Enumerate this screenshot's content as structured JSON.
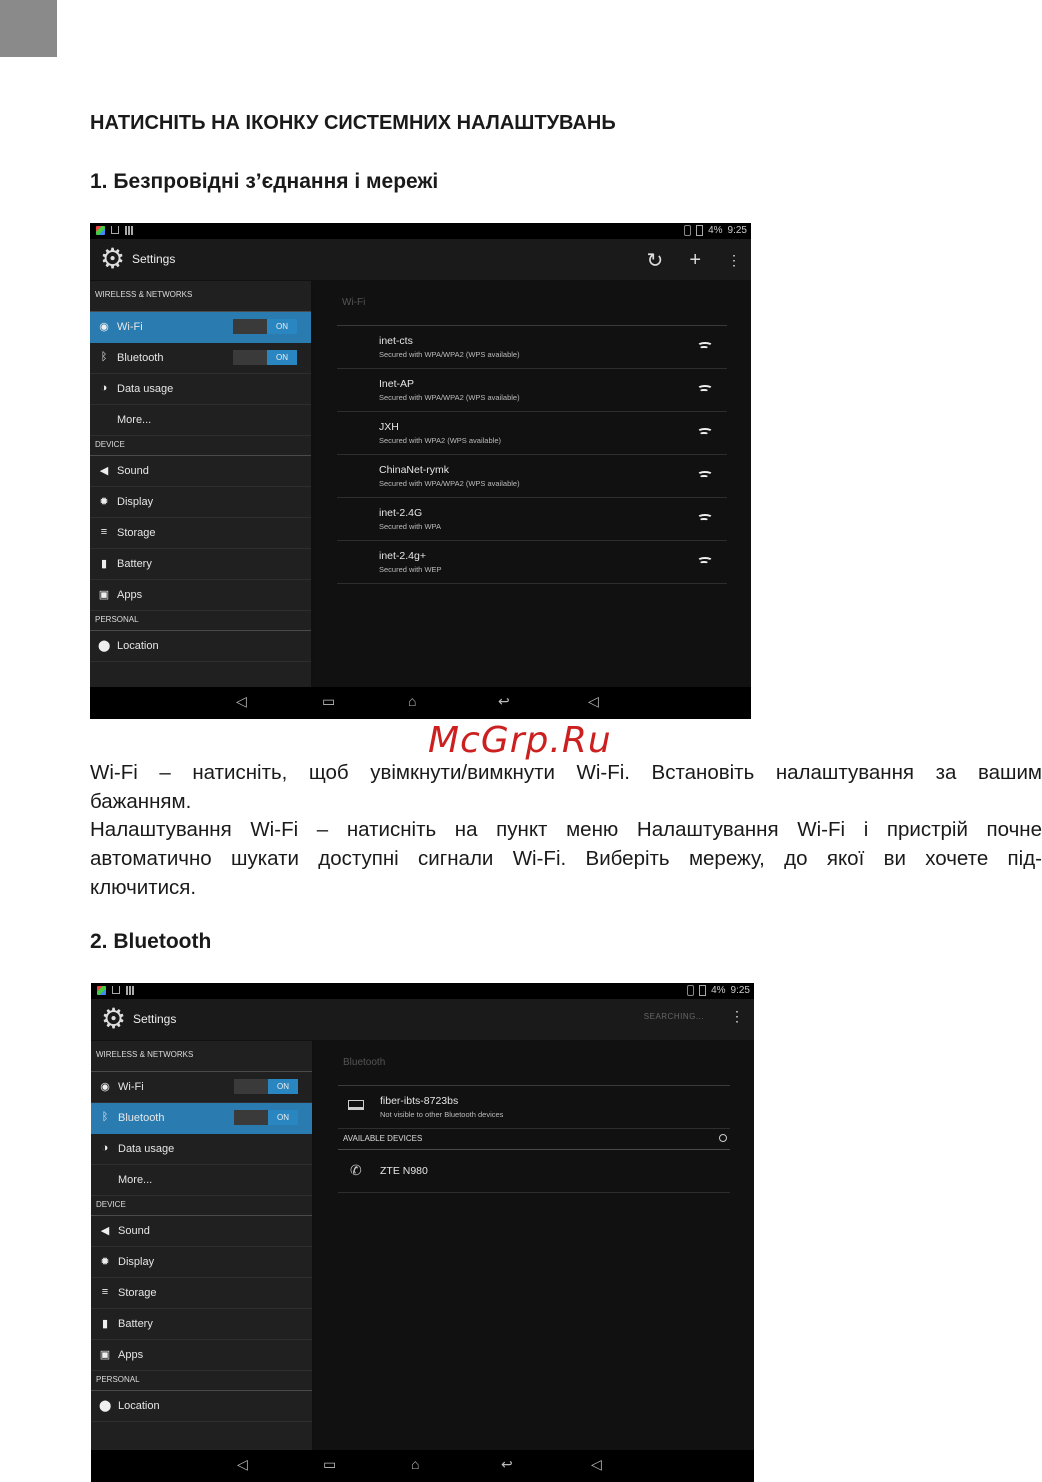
{
  "doc": {
    "heading": "НАТИСНІТЬ НА ІКОНКУ СИСТЕМНИХ НАЛАШТУВАНЬ",
    "section1": "1. Безпровідні з’єднання і мережі",
    "section2": "2. Bluetooth",
    "watermark": "McGrp.Ru",
    "para1_line1": "Wi-Fi – натисніть, щоб увімкнути/вимкнути Wi-Fi. Встановіть налаштування за вашим",
    "para1_line2": "бажанням.",
    "para2_line1": "Налаштування Wi-Fi – натисніть на пункт меню Налаштування Wi-Fi і пристрій почне",
    "para2_line2": "автоматично шукати доступні сигнали Wi-Fi. Виберіть мережу, до якої ви хочете під-",
    "para2_line3": "ключитися."
  },
  "screen": {
    "time": "9:25",
    "battery": "4%",
    "title": "Settings",
    "searching": "SEARCHING...",
    "toggle_on": "ON",
    "sections": {
      "wireless": "WIRELESS & NETWORKS",
      "device": "DEVICE",
      "personal": "PERSONAL"
    },
    "menu": {
      "wifi": "Wi-Fi",
      "bluetooth": "Bluetooth",
      "data_usage": "Data usage",
      "more": "More...",
      "sound": "Sound",
      "display": "Display",
      "storage": "Storage",
      "battery": "Battery",
      "apps": "Apps",
      "location": "Location"
    },
    "wifi_panel": {
      "header": "Wi-Fi",
      "networks": [
        {
          "name": "inet-cts",
          "security": "Secured with WPA/WPA2 (WPS available)"
        },
        {
          "name": "Inet-AP",
          "security": "Secured with WPA/WPA2 (WPS available)"
        },
        {
          "name": "JXH",
          "security": "Secured with WPA2 (WPS available)"
        },
        {
          "name": "ChinaNet-rymk",
          "security": "Secured with WPA/WPA2 (WPS available)"
        },
        {
          "name": "inet-2.4G",
          "security": "Secured with WPA"
        },
        {
          "name": "inet-2.4g+",
          "security": "Secured with WEP"
        }
      ]
    },
    "bt_panel": {
      "header": "Bluetooth",
      "device_name": "fiber-ibts-8723bs",
      "device_status": "Not visible to other Bluetooth devices",
      "available": "AVAILABLE DEVICES",
      "found": "ZTE N980"
    }
  }
}
